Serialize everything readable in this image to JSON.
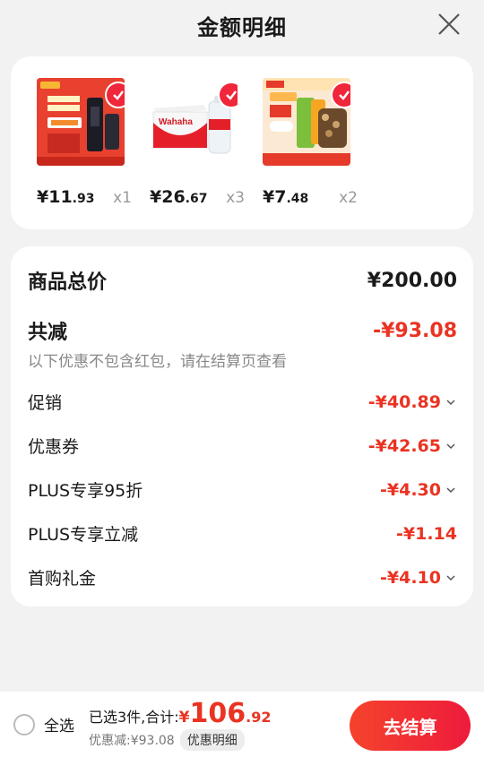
{
  "header": {
    "title": "金额明细"
  },
  "products": [
    {
      "price_int": "¥11",
      "price_dec": ".93",
      "qty": "x1",
      "icon": "product-thumb-red-promo"
    },
    {
      "price_int": "¥26",
      "price_dec": ".67",
      "qty": "x3",
      "icon": "product-thumb-water-box"
    },
    {
      "price_int": "¥7",
      "price_dec": ".48",
      "qty": "x2",
      "icon": "product-thumb-snacks"
    }
  ],
  "summary": {
    "total_label": "商品总价",
    "total_value": "¥200.00",
    "reduce_label": "共减",
    "reduce_value": "-¥93.08",
    "note": "以下优惠不包含红包，请在结算页查看",
    "items": [
      {
        "label": "促销",
        "value": "-¥40.89"
      },
      {
        "label": "优惠券",
        "value": "-¥42.65"
      },
      {
        "label": "PLUS专享95折",
        "value": "-¥4.30"
      },
      {
        "label": "PLUS专享立减",
        "value": "-¥1.14"
      },
      {
        "label": "首购礼金",
        "value": "-¥4.10"
      }
    ]
  },
  "footer": {
    "select_all": "全选",
    "selected_text": "已选3件,合计:",
    "total_yen": "¥",
    "total_int": "106",
    "total_dec": ".92",
    "discount_text": "优惠减:¥93.08",
    "detail_chip": "优惠明细",
    "checkout": "去结算"
  },
  "colors": {
    "accent": "#ea3322",
    "checkout_gradient_start": "#f5432c",
    "checkout_gradient_end": "#ee1b3c"
  }
}
